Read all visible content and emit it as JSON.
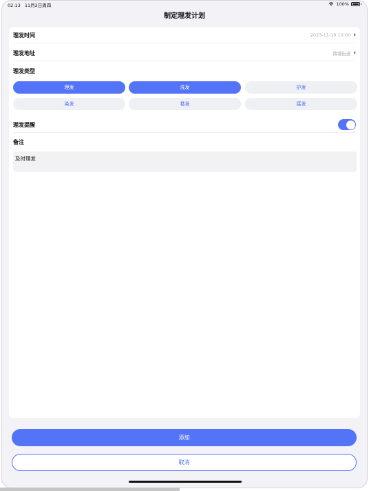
{
  "status_bar": {
    "time": "02:13",
    "date": "11月2日周四",
    "battery": "100%"
  },
  "header": {
    "title": "制定理发计划"
  },
  "form": {
    "time_label": "理发时间",
    "time_value": "2023-11-10 10:00",
    "address_label": "理发地址",
    "address_value": "南城街道",
    "type_label": "理发类型",
    "types": [
      {
        "label": "理发",
        "selected": true
      },
      {
        "label": "洗发",
        "selected": true
      },
      {
        "label": "护发",
        "selected": false
      },
      {
        "label": "染发",
        "selected": false
      },
      {
        "label": "卷发",
        "selected": false
      },
      {
        "label": "接发",
        "selected": false
      }
    ],
    "reminder_label": "理发提醒",
    "reminder_on": true,
    "notes_label": "备注",
    "notes_value": "及时理发"
  },
  "actions": {
    "add_label": "添加",
    "cancel_label": "取消"
  },
  "colors": {
    "accent": "#5474f8",
    "chip_bg": "#eef0f4",
    "page_bg": "#f2f2f7"
  }
}
